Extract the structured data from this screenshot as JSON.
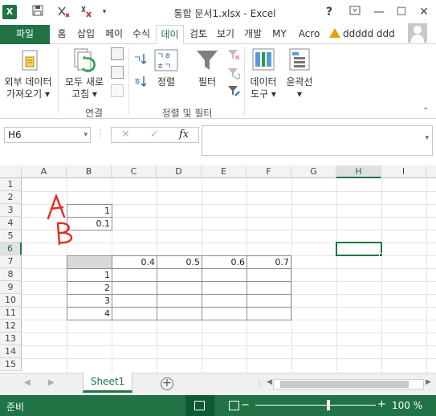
{
  "title_bar": {
    "logo": "X",
    "title": "통합 문서1.xlsx - Excel",
    "help": "?",
    "minimize": "—",
    "restore": "☐",
    "close": "✕"
  },
  "ribbon_tabs": [
    "파일",
    "홈",
    "삽입",
    "페이",
    "수식",
    "데이",
    "검토",
    "보기",
    "개발",
    "MY",
    "Acro"
  ],
  "active_tab": "데이",
  "user_name": "ddddd ddd",
  "ribbon": {
    "get_external": [
      "외부 데이터",
      "가져오기 ▾"
    ],
    "refresh_all": [
      "모두 새로",
      "고침 ▾"
    ],
    "connections_group": "연결",
    "sort": "정렬",
    "filter": "필터",
    "sort_filter_group": "정렬 및 필터",
    "data_tools": [
      "데이터",
      "도구 ▾"
    ],
    "outline": [
      "윤곽선",
      "▾"
    ]
  },
  "formula_bar": {
    "name_box": "H6",
    "fx": "fx",
    "formula": ""
  },
  "grid": {
    "columns": [
      "A",
      "B",
      "C",
      "D",
      "E",
      "F",
      "G",
      "H",
      "I"
    ],
    "rows": [
      "1",
      "2",
      "3",
      "4",
      "5",
      "6",
      "7",
      "8",
      "9",
      "10",
      "11",
      "12",
      "13",
      "14",
      "15"
    ],
    "selected_cell": "H6",
    "cells": {
      "B3": "1",
      "B4": "0.1",
      "C7": "0.4",
      "D7": "0.5",
      "E7": "0.6",
      "F7": "0.7",
      "B8": "1",
      "B9": "2",
      "B10": "3",
      "B11": "4"
    },
    "annotations": [
      "A",
      "B"
    ]
  },
  "sheets": [
    "Sheet1"
  ],
  "status": {
    "ready": "준비",
    "zoom": "100 %"
  },
  "colors": {
    "accent": "#217346",
    "annotation": "#e8281e"
  }
}
